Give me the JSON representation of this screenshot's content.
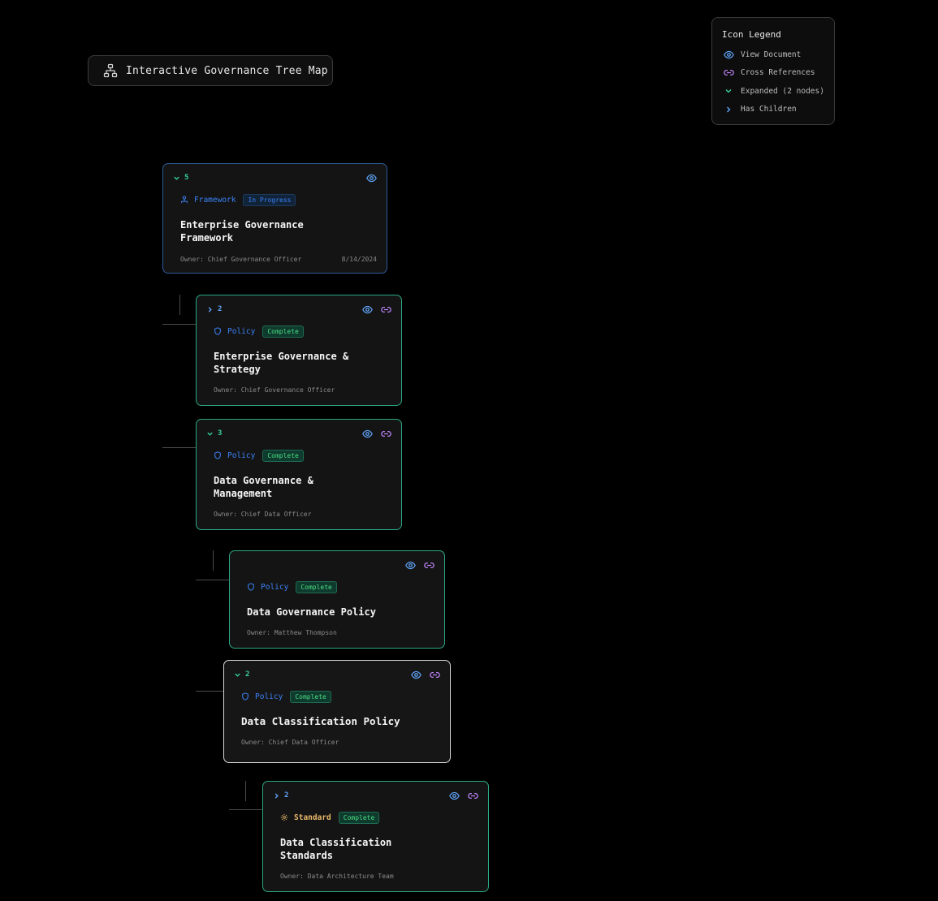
{
  "header": {
    "title": "Interactive Governance Tree Map",
    "icon": "hierarchy-icon"
  },
  "legend": {
    "title": "Icon Legend",
    "items": [
      {
        "icon": "eye-icon",
        "label": "View Document",
        "color": "#60a5fa"
      },
      {
        "icon": "link-icon",
        "label": "Cross References",
        "color": "#c084fc"
      },
      {
        "icon": "chevron-down-icon",
        "label": "Expanded (2 nodes)",
        "color": "#34d399"
      },
      {
        "icon": "chevron-right-icon",
        "label": "Has Children",
        "color": "#60a5fa"
      }
    ]
  },
  "nodes": [
    {
      "count": "5",
      "state": "expanded",
      "type": "Framework",
      "status": "In Progress",
      "title": "Enterprise Governance Framework",
      "owner": "Owner: Chief Governance Officer",
      "date": "8/14/2024"
    },
    {
      "count": "2",
      "state": "collapsed",
      "type": "Policy",
      "status": "Complete",
      "title": "Enterprise Governance & Strategy",
      "owner": "Owner: Chief Governance Officer"
    },
    {
      "count": "3",
      "state": "expanded",
      "type": "Policy",
      "status": "Complete",
      "title": "Data Governance & Management",
      "owner": "Owner: Chief Data Officer"
    },
    {
      "type": "Policy",
      "status": "Complete",
      "title": "Data Governance Policy",
      "owner": "Owner: Matthew Thompson"
    },
    {
      "count": "2",
      "state": "expanded",
      "type": "Policy",
      "status": "Complete",
      "title": "Data Classification Policy",
      "owner": "Owner: Chief Data Officer"
    },
    {
      "count": "2",
      "state": "collapsed",
      "type": "Standard",
      "status": "Complete",
      "title": "Data Classification Standards",
      "owner": "Owner: Data Architecture Team"
    }
  ],
  "colors": {
    "accent_blue": "#60a5fa",
    "accent_green": "#34d399",
    "accent_purple": "#c084fc",
    "accent_amber": "#e8b86a"
  }
}
